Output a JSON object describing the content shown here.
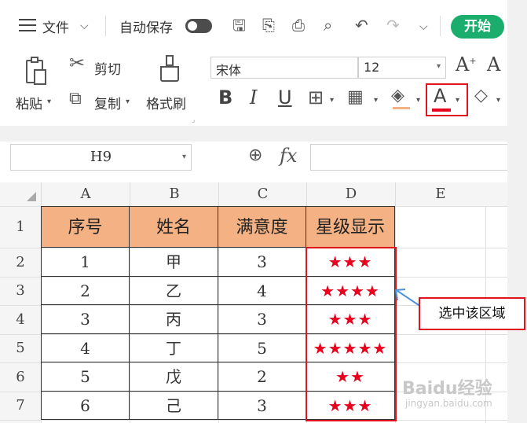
{
  "menu": {
    "file_label": "文件",
    "autosave_label": "自动保存",
    "start_label": "开始"
  },
  "clipboard": {
    "paste_label": "粘贴",
    "cut_label": "剪切",
    "copy_label": "复制",
    "format_painter_label": "格式刷"
  },
  "font": {
    "name": "宋体",
    "size": "12",
    "color": "#e8001c"
  },
  "formula_bar": {
    "cell_ref": "H9",
    "fx_label": "fx"
  },
  "sheet": {
    "columns": [
      "A",
      "B",
      "C",
      "D",
      "E"
    ],
    "rows": [
      "1",
      "2",
      "3",
      "4",
      "5",
      "6",
      "7"
    ],
    "headers": [
      "序号",
      "姓名",
      "满意度",
      "星级显示"
    ],
    "records": [
      {
        "no": "1",
        "name": "甲",
        "score": "3",
        "stars": "★★★"
      },
      {
        "no": "2",
        "name": "乙",
        "score": "4",
        "stars": "★★★★"
      },
      {
        "no": "3",
        "name": "丙",
        "score": "3",
        "stars": "★★★"
      },
      {
        "no": "4",
        "name": "丁",
        "score": "5",
        "stars": "★★★★★"
      },
      {
        "no": "5",
        "name": "戊",
        "score": "2",
        "stars": "★★"
      },
      {
        "no": "6",
        "name": "己",
        "score": "3",
        "stars": "★★★"
      }
    ]
  },
  "annotation": {
    "label": "选中该区域",
    "accent": "#e0141e"
  },
  "watermark": {
    "brand": "Baidu经验",
    "url": "jingyan.baidu.com"
  }
}
